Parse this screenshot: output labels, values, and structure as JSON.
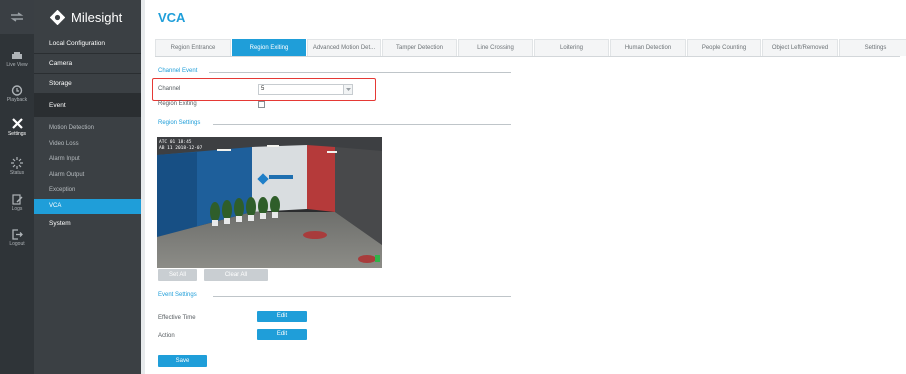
{
  "rail": {
    "items": [
      {
        "label": "Live View",
        "icon": "live-view-icon"
      },
      {
        "label": "Playback",
        "icon": "playback-icon"
      },
      {
        "label": "Settings",
        "icon": "settings-icon",
        "active": true
      },
      {
        "label": "Status",
        "icon": "status-icon"
      },
      {
        "label": "Logs",
        "icon": "logs-icon"
      },
      {
        "label": "Logout",
        "icon": "logout-icon"
      }
    ]
  },
  "brand": {
    "name": "Milesight"
  },
  "sidebar": {
    "sections": [
      {
        "label": "Local Configuration"
      },
      {
        "label": "Camera"
      },
      {
        "label": "Storage"
      },
      {
        "label": "Event",
        "active": true
      }
    ],
    "event_items": [
      "Motion Detection",
      "Video Loss",
      "Alarm Input",
      "Alarm Output",
      "Exception",
      "VCA"
    ],
    "system": "System"
  },
  "page": {
    "title": "VCA"
  },
  "tabs": [
    "Region Entrance",
    "Region Exiting",
    "Advanced Motion Det...",
    "Tamper Detection",
    "Line Crossing",
    "Loitering",
    "Human Detection",
    "People Counting",
    "Object Left/Removed",
    "Settings"
  ],
  "active_tab": "Region Exiting",
  "channel_event": {
    "heading": "Channel Event",
    "channel_label": "Channel",
    "channel_value": "5",
    "region_exiting_label": "Region Exiting",
    "region_exiting_checked": false
  },
  "region_settings": {
    "heading": "Region Settings",
    "osd_line1": "ATC 01 18:45",
    "osd_line2": "AB 11  2018-12-07",
    "set_all": "Set All",
    "clear_all": "Clear All"
  },
  "event_settings": {
    "heading": "Event Settings",
    "effective_time_label": "Effective Time",
    "action_label": "Action",
    "edit_label": "Edit",
    "save_label": "Save"
  },
  "colors": {
    "accent": "#1f9ed9",
    "highlight": "#e53935",
    "sidebar": "#3b4044",
    "rail": "#2f3438"
  }
}
